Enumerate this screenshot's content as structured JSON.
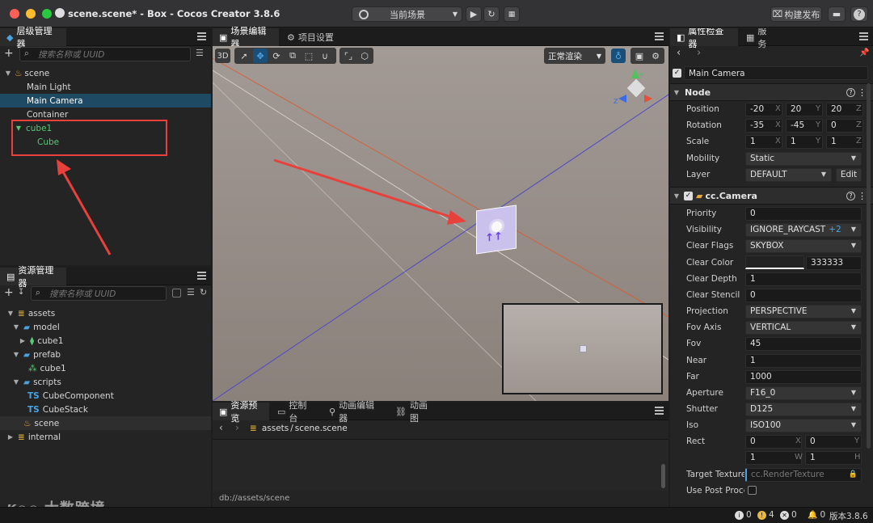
{
  "window": {
    "title": "scene.scene* - Box - Cocos Creator 3.8.6"
  },
  "titlebar": {
    "scene_select": "当前场景",
    "build_label": "构建发布"
  },
  "hierarchy": {
    "tab": "层级管理器",
    "search_placeholder": "搜索名称或 UUID",
    "items": [
      {
        "label": "scene"
      },
      {
        "label": "Main Light"
      },
      {
        "label": "Main Camera"
      },
      {
        "label": "Container"
      },
      {
        "label": "cube1"
      },
      {
        "label": "Cube"
      }
    ]
  },
  "assets": {
    "tab": "资源管理器",
    "search_placeholder": "搜索名称或 UUID",
    "items": [
      {
        "label": "assets"
      },
      {
        "label": "model"
      },
      {
        "label": "cube1"
      },
      {
        "label": "prefab"
      },
      {
        "label": "cube1"
      },
      {
        "label": "scripts"
      },
      {
        "label": "CubeComponent"
      },
      {
        "label": "CubeStack"
      },
      {
        "label": "scene"
      },
      {
        "label": "internal"
      }
    ]
  },
  "scene_editor": {
    "tabs": [
      "场景编辑器",
      "项目设置"
    ],
    "mode_3d": "3D",
    "render_mode": "正常渲染"
  },
  "bottom_panel": {
    "tabs": [
      "资源预览",
      "控制台",
      "动画编辑器",
      "动画图"
    ],
    "breadcrumb_root": "assets",
    "breadcrumb_sep": "/",
    "breadcrumb_file": "scene.scene",
    "path": "db://assets/scene"
  },
  "inspector": {
    "tabs": [
      "属性检查器",
      "服务"
    ],
    "node_name": "Main Camera",
    "node_section": "Node",
    "position": {
      "label": "Position",
      "x": "-20",
      "y": "20",
      "z": "20"
    },
    "rotation": {
      "label": "Rotation",
      "x": "-35",
      "y": "-45",
      "z": "0"
    },
    "scale": {
      "label": "Scale",
      "x": "1",
      "y": "1",
      "z": "1"
    },
    "mobility": {
      "label": "Mobility",
      "value": "Static"
    },
    "layer": {
      "label": "Layer",
      "value": "DEFAULT",
      "edit": "Edit"
    },
    "camera_section": "cc.Camera",
    "priority": {
      "label": "Priority",
      "value": "0"
    },
    "visibility": {
      "label": "Visibility",
      "value": "IGNORE_RAYCAST",
      "extra": "+2"
    },
    "clear_flags": {
      "label": "Clear Flags",
      "value": "SKYBOX"
    },
    "clear_color": {
      "label": "Clear Color",
      "value": "333333"
    },
    "clear_depth": {
      "label": "Clear Depth",
      "value": "1"
    },
    "clear_stencil": {
      "label": "Clear Stencil",
      "value": "0"
    },
    "projection": {
      "label": "Projection",
      "value": "PERSPECTIVE"
    },
    "fov_axis": {
      "label": "Fov Axis",
      "value": "VERTICAL"
    },
    "fov": {
      "label": "Fov",
      "value": "45"
    },
    "near": {
      "label": "Near",
      "value": "1"
    },
    "far": {
      "label": "Far",
      "value": "1000"
    },
    "aperture": {
      "label": "Aperture",
      "value": "F16_0"
    },
    "shutter": {
      "label": "Shutter",
      "value": "D125"
    },
    "iso": {
      "label": "Iso",
      "value": "ISO100"
    },
    "rect": {
      "label": "Rect",
      "x": "0",
      "y": "0",
      "w": "1",
      "h": "1"
    },
    "target_texture": {
      "label": "Target Texture",
      "value": "cc.RenderTexture"
    },
    "use_post_process": {
      "label": "Use Post Proce"
    },
    "axis_x": "X",
    "axis_y": "Y",
    "axis_z": "Z",
    "axis_w": "W",
    "axis_h": "H"
  },
  "statusbar": {
    "info": "0",
    "warn": "4",
    "error": "0",
    "notice": "0",
    "version": "版本3.8.6"
  },
  "watermark": {
    "text": "大数跨境"
  },
  "colors": {
    "selection": "#1f4a63",
    "accent": "#4aa3df",
    "green": "#57c873",
    "annotation": "#e8413c"
  }
}
